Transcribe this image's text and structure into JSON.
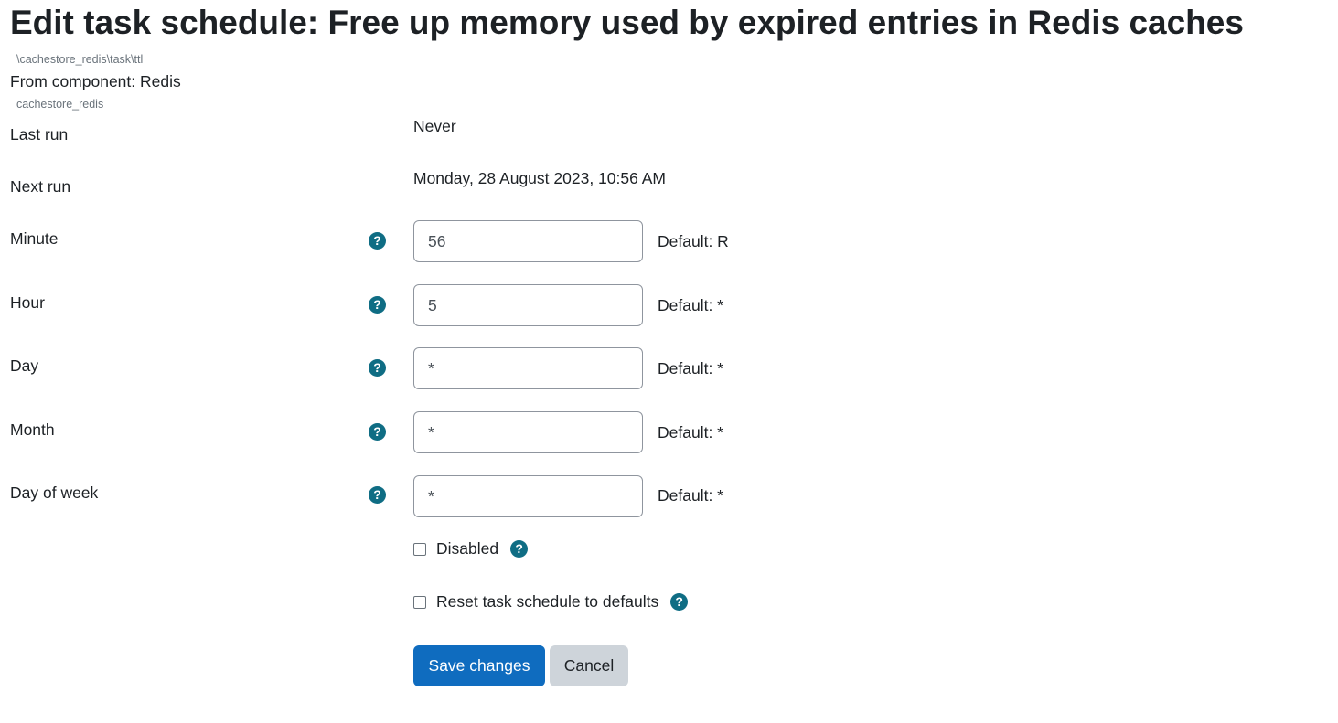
{
  "page": {
    "title": "Edit task schedule: Free up memory used by expired entries in Redis caches",
    "task_class": "\\cachestore_redis\\task\\ttl",
    "component_label": "From component: Redis",
    "component_name": "cachestore_redis"
  },
  "schedule": {
    "last_run_label": "Last run",
    "last_run_value": "Never",
    "next_run_label": "Next run",
    "next_run_value": "Monday, 28 August 2023, 10:56 AM"
  },
  "fields": [
    {
      "label": "Minute",
      "value": "56",
      "default": "Default: R"
    },
    {
      "label": "Hour",
      "value": "5",
      "default": "Default: *"
    },
    {
      "label": "Day",
      "value": "*",
      "default": "Default: *"
    },
    {
      "label": "Month",
      "value": "*",
      "default": "Default: *"
    },
    {
      "label": "Day of week",
      "value": "*",
      "default": "Default: *"
    }
  ],
  "checkboxes": {
    "disabled_label": "Disabled",
    "disabled_checked": false,
    "reset_label": "Reset task schedule to defaults",
    "reset_checked": false
  },
  "help_icon": {
    "icon": "question-circle-icon",
    "glyph": "?",
    "color": "#0f6d84"
  },
  "buttons": {
    "save_label": "Save changes",
    "cancel_label": "Cancel",
    "primary_color": "#0f6cbf",
    "secondary_color": "#ced4da"
  }
}
